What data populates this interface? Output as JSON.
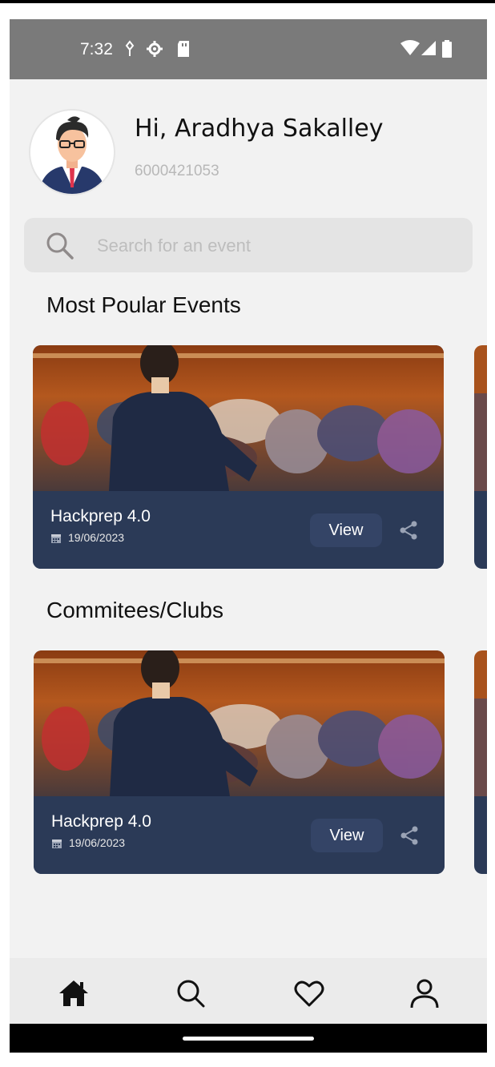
{
  "status_bar": {
    "time": "7:32",
    "icons": [
      "usb-debug-icon",
      "settings-gear-icon",
      "sd-card-icon",
      "wifi-icon",
      "cell-signal-icon",
      "battery-icon"
    ]
  },
  "profile": {
    "greeting": "Hi, Aradhya Sakalley",
    "phone": "6000421053",
    "avatar_icon": "user-avatar-icon"
  },
  "search": {
    "placeholder": "Search for an event"
  },
  "sections": [
    {
      "title": "Most Poular Events",
      "cards": [
        {
          "title": "Hackprep 4.0",
          "date": "19/06/2023",
          "action": "View"
        }
      ]
    },
    {
      "title": "Commitees/Clubs",
      "cards": [
        {
          "title": "Hackprep 4.0",
          "date": "19/06/2023",
          "action": "View"
        }
      ]
    }
  ],
  "bottom_nav": [
    "home-icon",
    "search-icon",
    "heart-icon",
    "profile-icon"
  ],
  "colors": {
    "card_bg": "#2b3a57",
    "button_bg": "#344466",
    "status_bar": "#7a7a7a",
    "page_bg": "#f2f2f2"
  }
}
